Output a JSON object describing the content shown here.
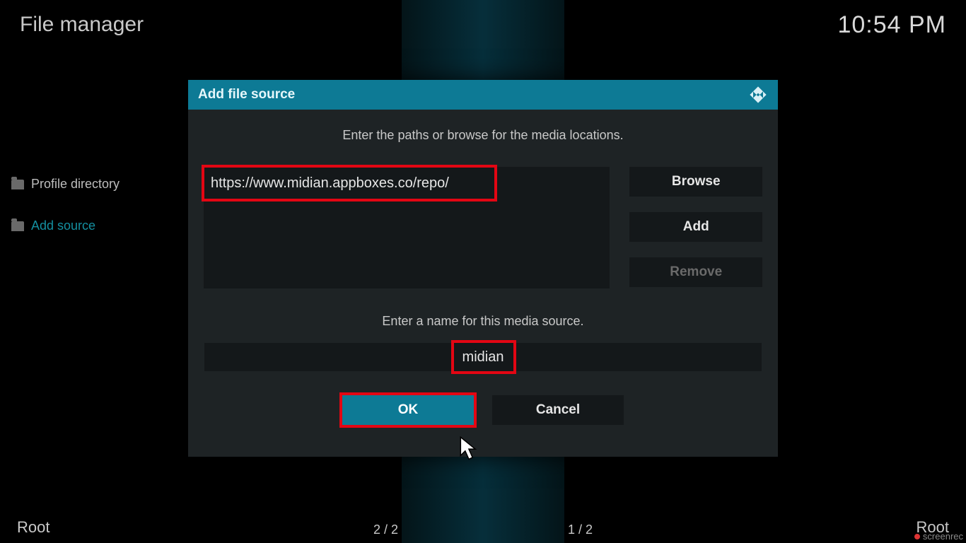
{
  "header": {
    "title": "File manager",
    "clock": "10:54 PM"
  },
  "sidebar": {
    "profile_label": "Profile directory",
    "add_label": "Add source"
  },
  "dialog": {
    "title": "Add file source",
    "instruction": "Enter the paths or browse for the media locations.",
    "path_value": "https://www.midian.appboxes.co/repo/",
    "browse_label": "Browse",
    "add_label": "Add",
    "remove_label": "Remove",
    "name_instruction": "Enter a name for this media source.",
    "name_value": "midian",
    "ok_label": "OK",
    "cancel_label": "Cancel"
  },
  "footer": {
    "left": "Root",
    "right": "Root",
    "count_left": "2 / 2",
    "count_right": "1 / 2"
  },
  "watermark": {
    "text": "screenrec"
  }
}
